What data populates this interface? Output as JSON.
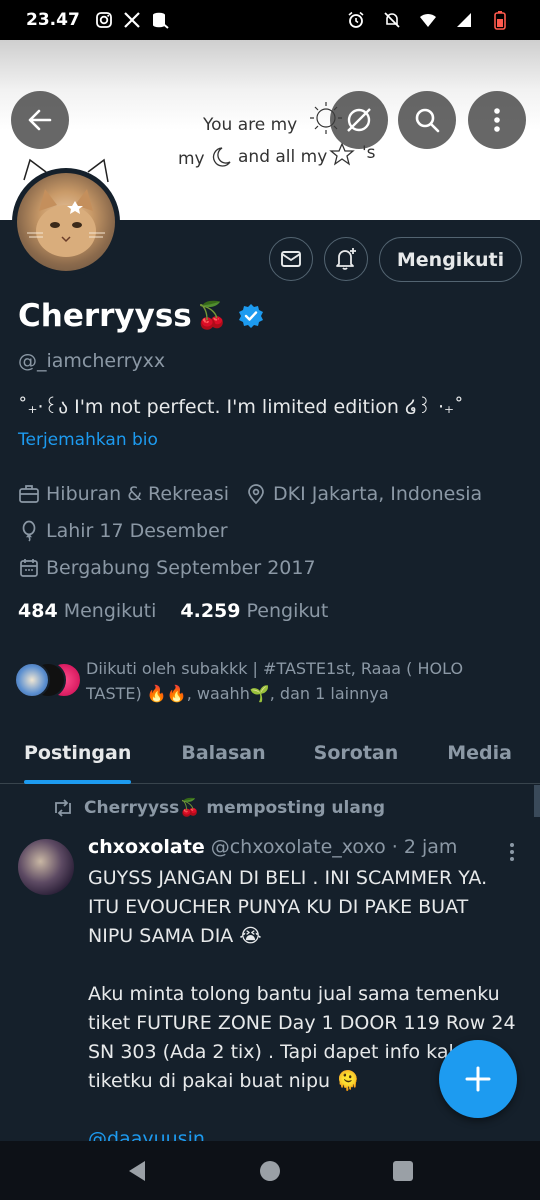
{
  "status_bar": {
    "time": "23.47",
    "icons": [
      "instagram-icon",
      "x-icon",
      "database-icon",
      "alarm-icon",
      "mute-icon",
      "wifi-icon",
      "signal-icon",
      "battery-low-icon"
    ]
  },
  "banner": {
    "line1": "You are my",
    "line2_start": "my",
    "line2_mid": "and all my",
    "line2_end": "'s"
  },
  "header_buttons": [
    "back-icon",
    "no-camera-icon",
    "search-icon",
    "more-icon"
  ],
  "profile": {
    "name": "Cherryyss",
    "name_emoji": "🍒",
    "handle": "@_iamcherryxx",
    "bio": "˚₊‧꒰ა I'm not perfect. I'm limited edition ໒꒱ ‧₊˚",
    "translate_label": "Terjemahkan bio",
    "category": "Hiburan & Rekreasi",
    "location": "DKI Jakarta, Indonesia",
    "birthday": "Lahir 17 Desember",
    "joined": "Bergabung September 2017",
    "following_count": "484",
    "following_label": "Mengikuti",
    "followers_count": "4.259",
    "followers_label": "Pengikut",
    "follow_button_label": "Mengikuti",
    "followed_by_line1": "Diikuti oleh subakkk | #TASTE1st, Raaa ( HOLO",
    "followed_by_line2": "TASTE) 🔥🔥, waahh🌱, dan 1 lainnya"
  },
  "tabs": [
    {
      "label": "Postingan",
      "active": true
    },
    {
      "label": "Balasan",
      "active": false
    },
    {
      "label": "Sorotan",
      "active": false
    },
    {
      "label": "Media",
      "active": false
    }
  ],
  "post": {
    "repost_label": "Cherryyss🍒 memposting ulang",
    "author_name": "chxoxolate",
    "author_handle": "@chxoxolate_xoxo",
    "time": "· 2 jam",
    "paragraph1": "GUYSS JANGAN DI BELI . INI SCAMMER YA. ITU EVOUCHER PUNYA KU DI PAKE BUAT NIPU SAMA DIA 😭",
    "paragraph2": "Aku minta tolong bantu jual sama temenku tiket FUTURE ZONE Day 1 DOOR 119 Row 24 SN 303 (Ada 2 tix) . Tapi dapet info kalo tiketku di pakai buat nipu 🫠",
    "mention": "@daayuusin"
  },
  "colors": {
    "background": "#15202b",
    "accent": "#1d9bf0",
    "secondary_text": "#8b98a5",
    "border": "#536471"
  }
}
